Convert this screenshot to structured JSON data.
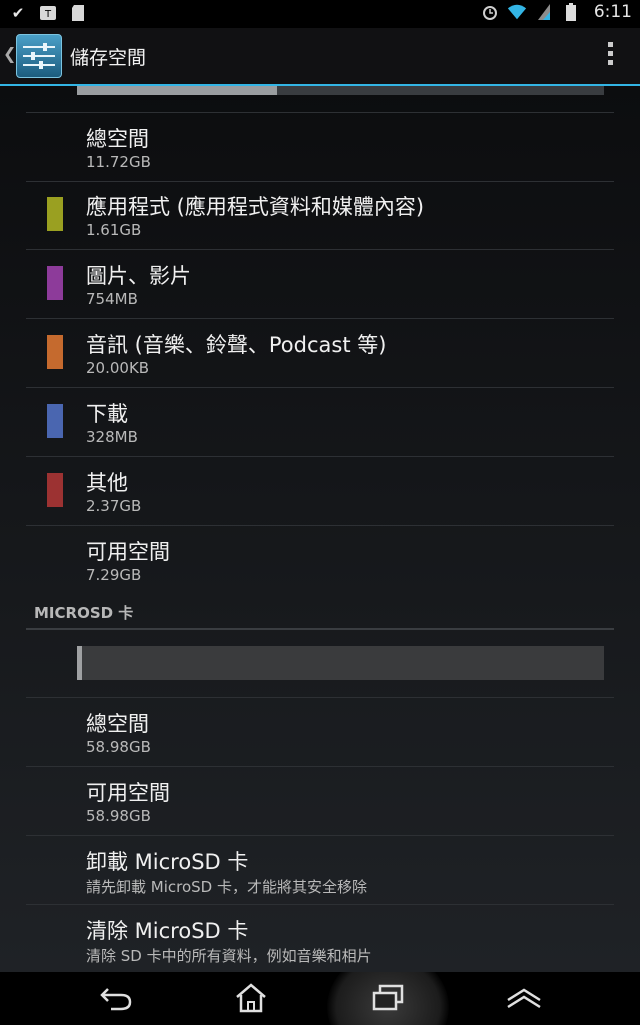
{
  "status_bar": {
    "left_icons": [
      "check-icon",
      "t-notification-icon",
      "sd-card-icon"
    ],
    "right_icons": [
      "alarm-icon",
      "wifi-icon",
      "signal-icon",
      "battery-icon"
    ],
    "time": "6:11"
  },
  "action_bar": {
    "title": "儲存空間",
    "app_icon": "settings-sliders-icon",
    "overflow_icon": "overflow-menu-icon",
    "accent_color": "#33b5e5"
  },
  "internal_storage": {
    "usage_fraction": 0.38,
    "items": [
      {
        "title": "總空間",
        "value": "11.72GB",
        "color": ""
      },
      {
        "title": "應用程式 (應用程式資料和媒體內容)",
        "value": "1.61GB",
        "color": "#9aa021"
      },
      {
        "title": "圖片、影片",
        "value": "754MB",
        "color": "#8d3b9a"
      },
      {
        "title": "音訊 (音樂、鈴聲、Podcast 等)",
        "value": "20.00KB",
        "color": "#c56a2e"
      },
      {
        "title": "下載",
        "value": "328MB",
        "color": "#4a66b0"
      },
      {
        "title": "其他",
        "value": "2.37GB",
        "color": "#9c3232"
      },
      {
        "title": "可用空間",
        "value": "7.29GB",
        "color": ""
      }
    ]
  },
  "microsd": {
    "header": "MICROSD 卡",
    "usage_fraction": 0.01,
    "items": [
      {
        "title": "總空間",
        "value": "58.98GB"
      },
      {
        "title": "可用空間",
        "value": "58.98GB"
      },
      {
        "title": "卸載 MicroSD 卡",
        "value": "請先卸載 MicroSD 卡，才能將其安全移除"
      },
      {
        "title": "清除 MicroSD 卡",
        "value": "清除 SD 卡中的所有資料，例如音樂和相片"
      }
    ]
  },
  "nav_bar": {
    "icons": [
      "back-icon",
      "home-icon",
      "recent-apps-icon",
      "menu-up-icon"
    ]
  }
}
